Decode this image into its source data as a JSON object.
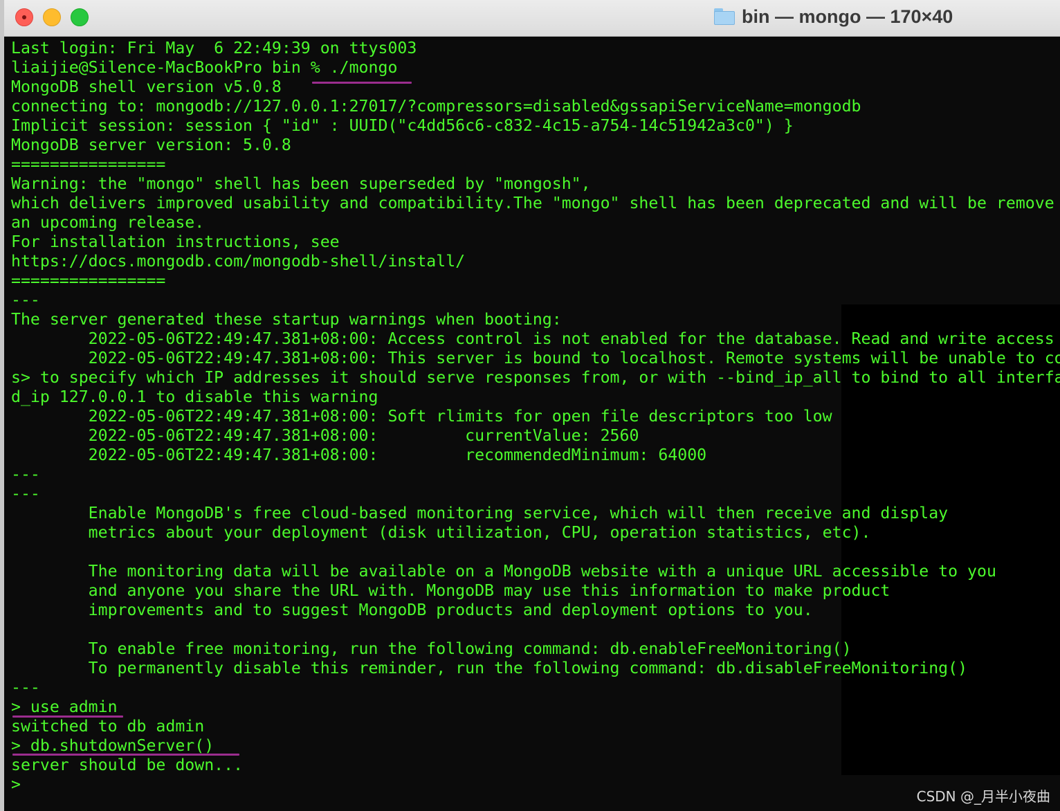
{
  "window": {
    "title": "bin — mongo — 170×40"
  },
  "terminal": {
    "lines": [
      "Last login: Fri May  6 22:49:39 on ttys003",
      "liaijie@Silence-MacBookPro bin % ./mongo",
      "MongoDB shell version v5.0.8",
      "connecting to: mongodb://127.0.0.1:27017/?compressors=disabled&gssapiServiceName=mongodb",
      "Implicit session: session { \"id\" : UUID(\"c4dd56c6-c832-4c15-a754-14c51942a3c0\") }",
      "MongoDB server version: 5.0.8",
      "================",
      "Warning: the \"mongo\" shell has been superseded by \"mongosh\",",
      "which delivers improved usability and compatibility.The \"mongo\" shell has been deprecated and will be remove",
      "an upcoming release.",
      "For installation instructions, see",
      "https://docs.mongodb.com/mongodb-shell/install/",
      "================",
      "---",
      "The server generated these startup warnings when booting:",
      "        2022-05-06T22:49:47.381+08:00: Access control is not enabled for the database. Read and write access",
      "        2022-05-06T22:49:47.381+08:00: This server is bound to localhost. Remote systems will be unable to co",
      "s> to specify which IP addresses it should serve responses from, or with --bind_ip_all to bind to all interfa",
      "d_ip 127.0.0.1 to disable this warning",
      "        2022-05-06T22:49:47.381+08:00: Soft rlimits for open file descriptors too low",
      "        2022-05-06T22:49:47.381+08:00:         currentValue: 2560",
      "        2022-05-06T22:49:47.381+08:00:         recommendedMinimum: 64000",
      "---",
      "---",
      "        Enable MongoDB's free cloud-based monitoring service, which will then receive and display",
      "        metrics about your deployment (disk utilization, CPU, operation statistics, etc).",
      "",
      "        The monitoring data will be available on a MongoDB website with a unique URL accessible to you",
      "        and anyone you share the URL with. MongoDB may use this information to make product",
      "        improvements and to suggest MongoDB products and deployment options to you.",
      "",
      "        To enable free monitoring, run the following command: db.enableFreeMonitoring()",
      "        To permanently disable this reminder, run the following command: db.disableFreeMonitoring()",
      "---",
      "> use admin",
      "switched to db admin",
      "> db.shutdownServer()",
      "server should be down...",
      ">"
    ]
  },
  "watermark": "CSDN @_月半小夜曲",
  "colors": {
    "terminal_text": "#4cfa2c",
    "terminal_bg": "#0b0b0b",
    "underline": "#9b2d8e"
  }
}
